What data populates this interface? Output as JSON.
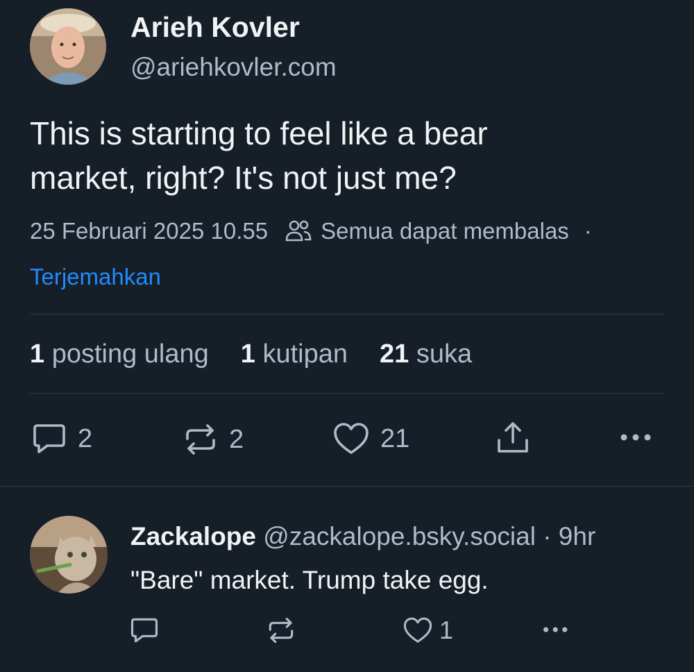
{
  "post": {
    "author": {
      "name": "Arieh Kovler",
      "handle": "@ariehkovler.com"
    },
    "text_line1": "This is starting to feel like a bear",
    "text_line2": "market, right? It's not just me?",
    "timestamp": "25 Februari 2025 10.55",
    "reply_setting": "Semua dapat membalas",
    "separator_dot": "·",
    "translate_label": "Terjemahkan",
    "stats": {
      "reposts_count": "1",
      "reposts_label": "posting ulang",
      "quotes_count": "1",
      "quotes_label": "kutipan",
      "likes_count": "21",
      "likes_label": "suka"
    },
    "actions": {
      "reply_count": "2",
      "repost_count": "2",
      "like_count": "21"
    }
  },
  "reply": {
    "author_name": "Zackalope",
    "author_handle": "@zackalope.bsky.social",
    "time": "· 9hr",
    "text": "\"Bare\" market. Trump take egg.",
    "actions": {
      "like_count": "1"
    }
  },
  "colors": {
    "background": "#161e27",
    "text_primary": "#f1f3f5",
    "text_secondary": "#aebbc9",
    "link": "#208bfe",
    "divider": "#2e3a48"
  },
  "icons": [
    "people-icon",
    "reply-icon",
    "repost-icon",
    "like-icon",
    "share-icon",
    "more-icon"
  ]
}
